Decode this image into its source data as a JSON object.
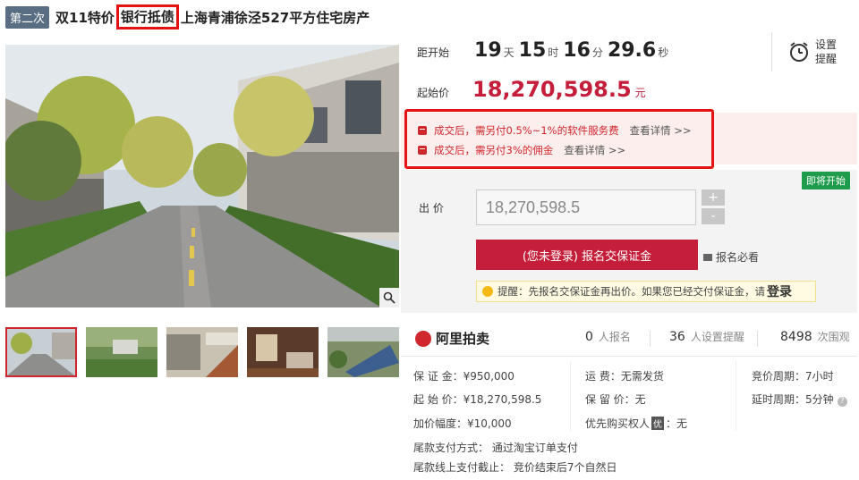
{
  "title": {
    "round": "第二次",
    "prefix": "双11特价",
    "highlight": "银行抵债",
    "suffix": "上海青浦徐泾527平方住宅房产"
  },
  "countdown": {
    "label": "距开始",
    "days": "19",
    "days_unit": "天",
    "hours": "15",
    "hours_unit": "时",
    "minutes": "16",
    "minutes_unit": "分",
    "seconds": "29.6",
    "seconds_unit": "秒"
  },
  "remind": {
    "label": "设置提醒",
    "icon": "clock-icon"
  },
  "start_price": {
    "label": "起始价",
    "value": "18,270,598.5",
    "unit": "元"
  },
  "fees": [
    {
      "text": "成交后，需另付0.5%~1%的软件服务费",
      "link": "查看详情 >>"
    },
    {
      "text": "成交后，需另付3%的佣金",
      "link": "查看详情 >>"
    }
  ],
  "status_badge": "即将开始",
  "bid": {
    "label": "出  价",
    "value": "18,270,598.5",
    "plus": "+",
    "minus": "-",
    "register_button": "(您未登录) 报名交保证金",
    "must_read": "报名必看"
  },
  "tip": {
    "text": "提醒：先报名交保证金再出价。如果您已经交付保证金，请",
    "login": "登录"
  },
  "brand": "阿里拍卖",
  "stats": [
    {
      "num": "0",
      "label": "人报名"
    },
    {
      "num": "36",
      "label": "人设置提醒"
    },
    {
      "num": "8498",
      "label": "次围观"
    }
  ],
  "info": {
    "deposit": "保 证 金：¥950,000",
    "start": "起 始 价：¥18,270,598.5",
    "increment": "加价幅度：¥10,000",
    "shipping": "运      费：无需发货",
    "reserve": "保 留 价：无",
    "priority_prefix": "优先购买权人",
    "priority_tag": "优",
    "priority_suffix": "：无",
    "cycle": "竞价周期：7小时",
    "delay": "延时周期：5分钟",
    "payment_method": "尾款支付方式：  通过淘宝订单支付",
    "payment_deadline": "尾款线上支付截止：  竞价结束后7个自然日"
  },
  "colors": {
    "accent": "#c41e3a",
    "highlight_border": "#e41212",
    "badge_green": "#1e9b4b"
  }
}
